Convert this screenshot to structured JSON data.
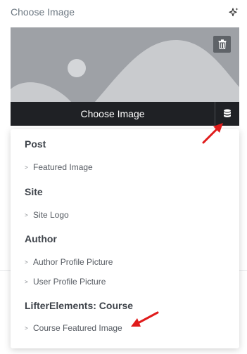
{
  "control": {
    "title": "Choose Image"
  },
  "media": {
    "choose_label": "Choose Image"
  },
  "dynamic_menu": {
    "groups": [
      {
        "title": "Post",
        "items": [
          "Featured Image"
        ]
      },
      {
        "title": "Site",
        "items": [
          "Site Logo"
        ]
      },
      {
        "title": "Author",
        "items": [
          "Author Profile Picture",
          "User Profile Picture"
        ]
      },
      {
        "title": "LifterElements: Course",
        "items": [
          "Course Featured Image"
        ]
      }
    ]
  },
  "colors": {
    "accent_arrow": "#e01b1b",
    "choose_bar": "#1f2125",
    "placeholder_bg": "#9ea1a6"
  },
  "icons": [
    "ai-sparkle-icon",
    "trash-icon",
    "database-icon",
    "chevron-right-icon"
  ]
}
